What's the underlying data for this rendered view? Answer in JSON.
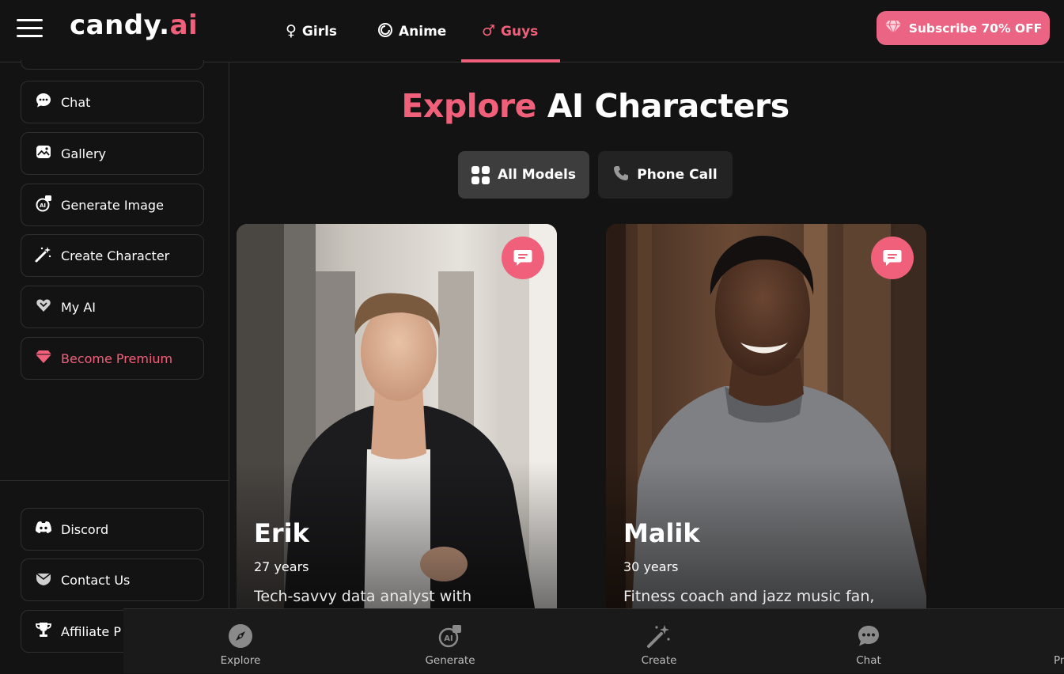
{
  "header": {
    "logo_main": "candy.",
    "logo_accent": "ai",
    "nav": [
      {
        "label": "Girls",
        "icon": "female-symbol-icon"
      },
      {
        "label": "Anime",
        "icon": "swirl-icon"
      },
      {
        "label": "Guys",
        "icon": "male-symbol-icon"
      }
    ],
    "subscribe_label": "Subscribe 70% OFF"
  },
  "sidebar": {
    "items": [
      {
        "label": "Chat",
        "icon": "chat-bubble-icon"
      },
      {
        "label": "Gallery",
        "icon": "gallery-icon"
      },
      {
        "label": "Generate Image",
        "icon": "generate-image-icon"
      },
      {
        "label": "Create Character",
        "icon": "magic-wand-icon"
      },
      {
        "label": "My AI",
        "icon": "heart-icon"
      },
      {
        "label": "Become Premium",
        "icon": "diamond-icon"
      }
    ],
    "bottom_items": [
      {
        "label": "Discord",
        "icon": "discord-icon"
      },
      {
        "label": "Contact Us",
        "icon": "contact-icon"
      },
      {
        "label": "Affiliate P",
        "icon": "trophy-icon"
      }
    ]
  },
  "main": {
    "title_accent": "Explore",
    "title_rest": "AI Characters",
    "tabs": [
      {
        "label": "All Models",
        "icon": "grid-icon"
      },
      {
        "label": "Phone Call",
        "icon": "phone-icon"
      }
    ],
    "cards": [
      {
        "name": "Erik",
        "age": "27 years",
        "desc": "Tech-savvy data analyst with"
      },
      {
        "name": "Malik",
        "age": "30 years",
        "desc": "Fitness coach and jazz music fan,"
      }
    ]
  },
  "bottom_nav": [
    {
      "label": "Explore",
      "icon": "compass-icon"
    },
    {
      "label": "Generate",
      "icon": "generate-icon"
    },
    {
      "label": "Create",
      "icon": "magic-wand-icon"
    },
    {
      "label": "Chat",
      "icon": "chat-bubble-icon"
    },
    {
      "label": "Pr"
    }
  ],
  "colors": {
    "accent": "#f0607a",
    "background": "#131313"
  }
}
